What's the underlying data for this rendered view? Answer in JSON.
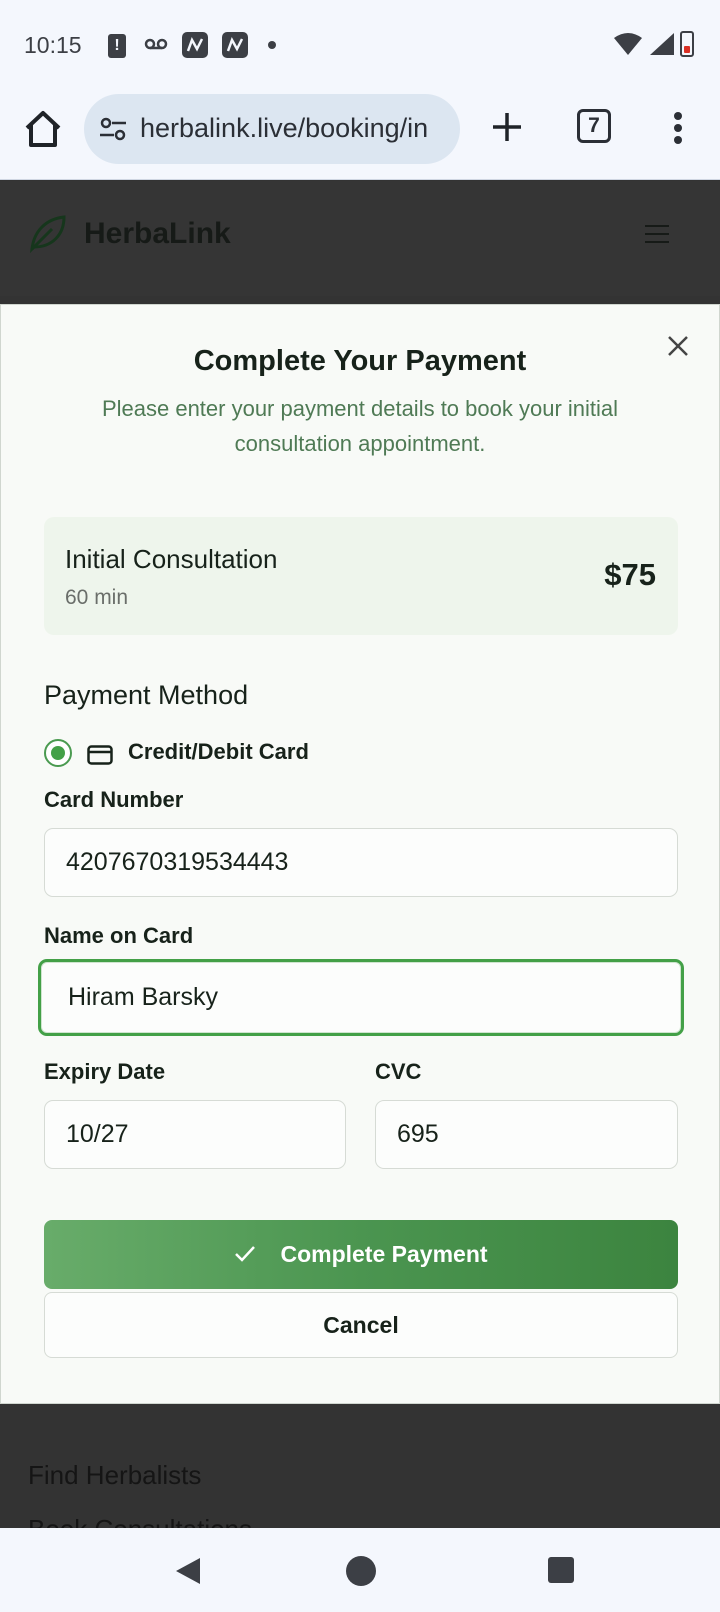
{
  "status_bar": {
    "time": "10:15"
  },
  "browser": {
    "url": "herbalink.live/booking/in",
    "tab_count": "7"
  },
  "page": {
    "brand": "HerbaLink",
    "footer_links": [
      "Find Herbalists",
      "Book Consultations"
    ]
  },
  "modal": {
    "title": "Complete Your Payment",
    "subtitle": "Please enter your payment details to book your initial consultation appointment.",
    "service": {
      "name": "Initial Consultation",
      "duration": "60 min",
      "price": "$75"
    },
    "payment_method_label": "Payment Method",
    "payment_option": "Credit/Debit Card",
    "card_number_label": "Card Number",
    "card_number_value": "4207670319534443",
    "name_label": "Name on Card",
    "name_value": "Hiram Barsky",
    "expiry_label": "Expiry Date",
    "expiry_value": "10/27",
    "cvc_label": "CVC",
    "cvc_value": "695",
    "submit_label": "Complete Payment",
    "cancel_label": "Cancel"
  },
  "colors": {
    "accent": "#43a047",
    "status_bar_bg": "#f4f7fd",
    "modal_bg": "#f8faf7",
    "subtitle_green": "#4f7a55"
  },
  "icons": [
    "alert-icon",
    "voicemail-icon",
    "app-icon",
    "wifi-icon",
    "signal-icon",
    "battery-icon",
    "home-icon",
    "tune-icon",
    "plus-icon",
    "more-vert-icon",
    "leaf-icon",
    "hamburger-icon",
    "close-icon",
    "credit-card-icon",
    "check-icon",
    "back-icon",
    "home-circle-icon",
    "recents-icon"
  ]
}
